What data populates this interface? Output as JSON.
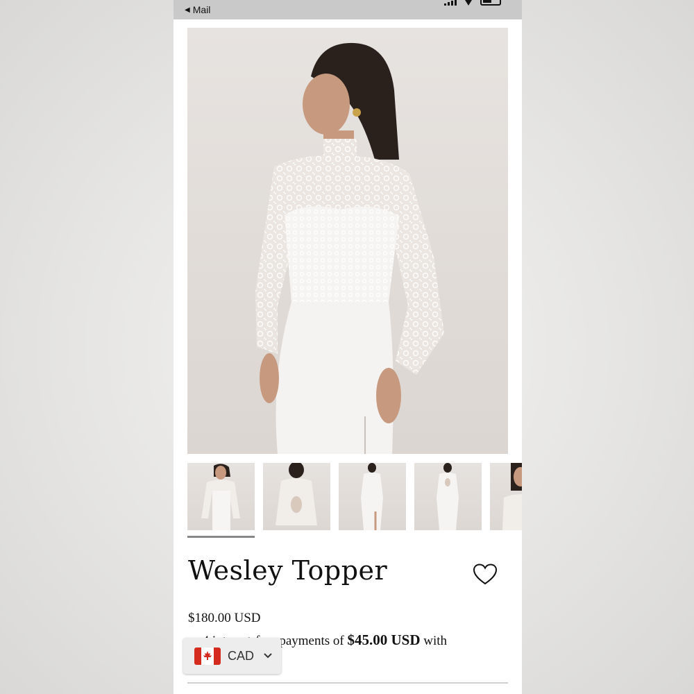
{
  "status_bar": {
    "back_label": "Mail"
  },
  "product": {
    "title": "Wesley Topper",
    "price": "$180.00 USD",
    "installment_prefix": "or 4 interest-free payments of ",
    "installment_amount": "$45.00 USD",
    "installment_suffix": " with"
  },
  "gallery": {
    "thumbnail_count": 5,
    "selected_index": 0
  },
  "currency_selector": {
    "code": "CAD",
    "flag": "canada-flag-icon"
  },
  "colors": {
    "background": "#ffffff",
    "status_bar": "#c9c9c9",
    "dress": "#f5f3f1",
    "text": "#111111"
  }
}
